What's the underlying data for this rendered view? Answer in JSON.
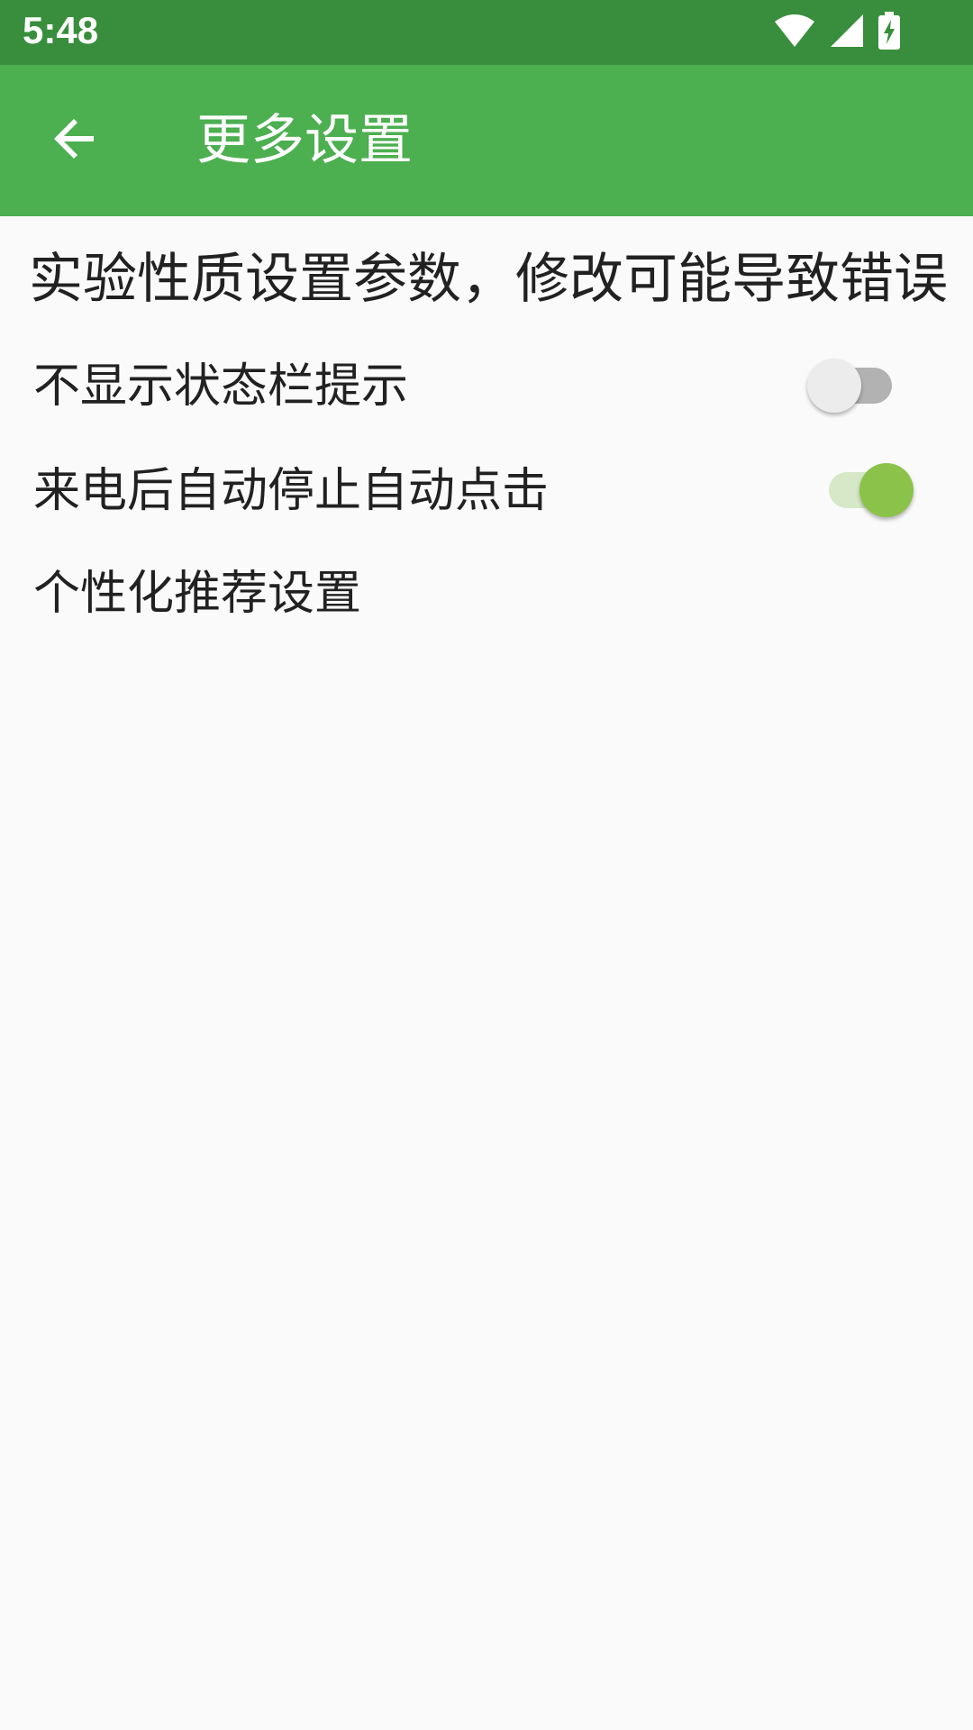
{
  "status_bar": {
    "time": "5:48",
    "icons": [
      "wifi-icon",
      "signal-icon",
      "battery-charging-icon"
    ]
  },
  "app_bar": {
    "back_icon": "arrow-back-icon",
    "title": "更多设置",
    "color": "#4caf50"
  },
  "content": {
    "warning": "实验性质设置参数，修改可能导致错误",
    "settings": [
      {
        "label": "不显示状态栏提示",
        "toggle": false
      },
      {
        "label": "来电后自动停止自动点击",
        "toggle": true
      },
      {
        "label": "个性化推荐设置"
      }
    ]
  },
  "colors": {
    "status_bar": "#388e3c",
    "app_bar": "#4caf50",
    "switch_on": "#8bc34a",
    "switch_off_track": "#b2b2b2",
    "background": "#fafafa"
  }
}
